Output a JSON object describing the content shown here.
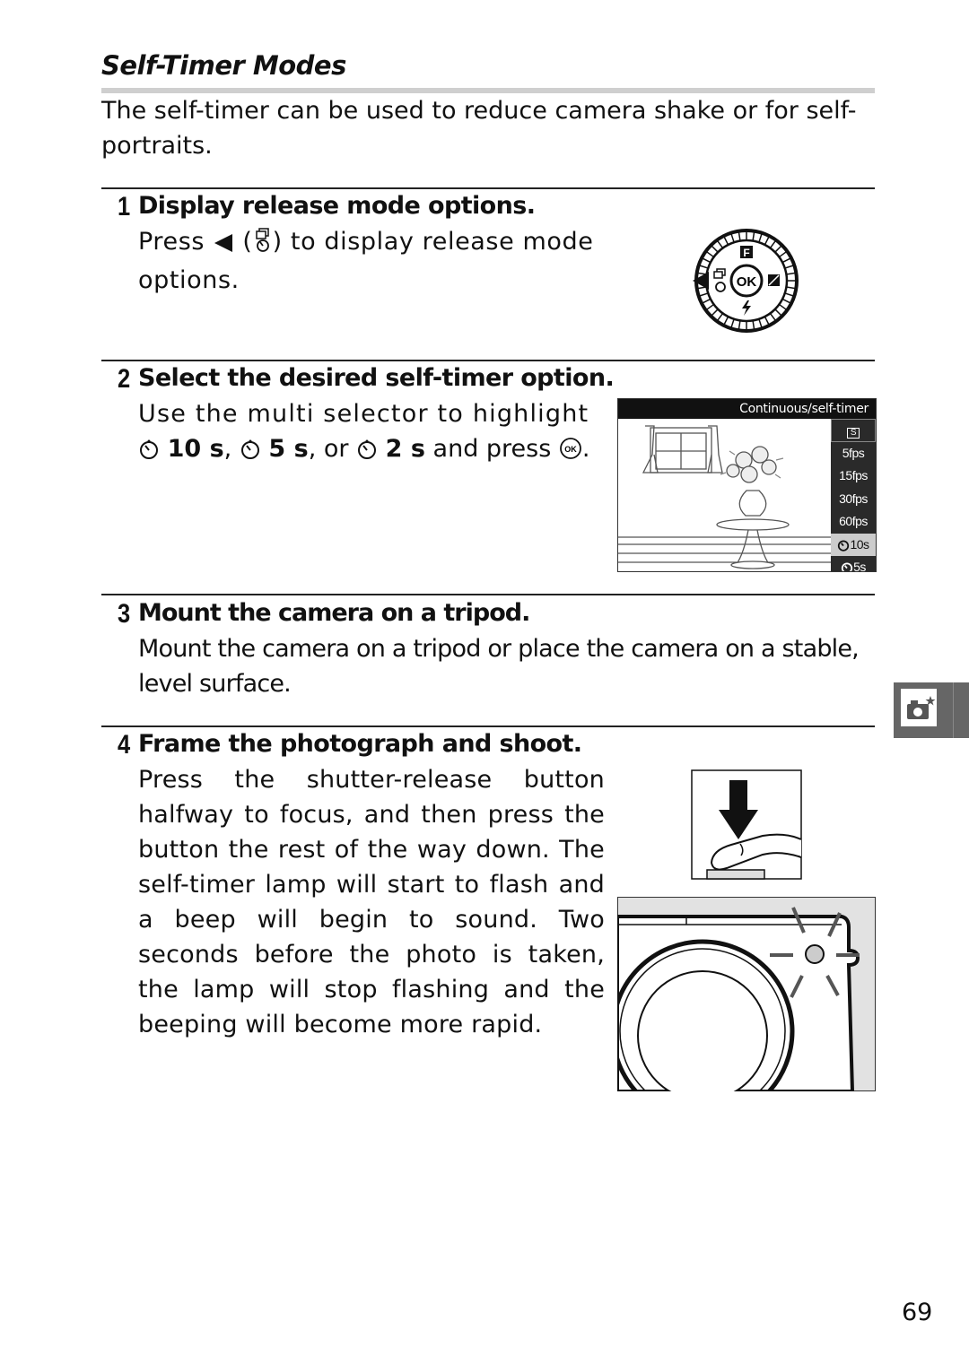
{
  "section": {
    "title": "Self-Timer Modes",
    "intro": "The self-timer can be used to reduce camera shake or for self-portraits."
  },
  "steps": [
    {
      "number": "1",
      "heading": "Display release mode options.",
      "body": {
        "before": "Press",
        "arrow_icon": "left-arrow-icon",
        "mode_icon": "release-mode-icon",
        "after": "to display release mode options."
      }
    },
    {
      "number": "2",
      "heading": "Select the desired self-timer option.",
      "body": {
        "line1": "Use the multi selector to highlight",
        "opt1": "10 s",
        "opt2": "5 s",
        "opt3": "2 s",
        "sep1": ",",
        "sep2": ", or",
        "after": "and press",
        "end": "."
      }
    },
    {
      "number": "3",
      "heading": "Mount the camera on a tripod.",
      "body": "Mount the camera on a tripod or place the camera on a stable, level surface."
    },
    {
      "number": "4",
      "heading": "Frame the photograph and shoot.",
      "body": "Press the shutter-release button halfway to focus, and then press the button the rest of the way down. The self-timer lamp will start to flash and a beep will begin to sound. Two seconds before the photo is taken, the lamp will stop flashing and the beeping will become more rapid."
    }
  ],
  "dial": {
    "top": "F",
    "center": "OK",
    "right": "exposure-compensation-icon",
    "bottom": "flash-icon",
    "left": "release-mode-icon"
  },
  "lcd": {
    "title": "Continuous/self-timer",
    "items": [
      {
        "label": "S",
        "selected": false
      },
      {
        "label": "5fps",
        "selected": false
      },
      {
        "label": "15fps",
        "selected": false
      },
      {
        "label": "30fps",
        "selected": false
      },
      {
        "label": "60fps",
        "selected": false
      },
      {
        "label": "10s",
        "selected": true,
        "icon": "self-timer-icon"
      },
      {
        "label": "5s",
        "selected": false,
        "icon": "self-timer-icon"
      }
    ]
  },
  "side_tab": {
    "icon": "camera-star-icon"
  },
  "page_number": "69"
}
